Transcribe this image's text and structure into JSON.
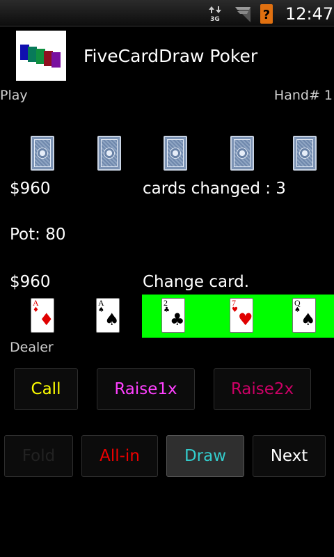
{
  "status_bar": {
    "network": "3G",
    "time": "12:47",
    "icons": [
      "data-arrows-icon",
      "signal-icon",
      "alert-icon"
    ]
  },
  "header": {
    "title": "FiveCardDraw Poker",
    "icon": "app-cards-icon"
  },
  "info": {
    "mode": "Play",
    "hand": "Hand# 1"
  },
  "opponent": {
    "money": "$960",
    "status": "cards changed : 3",
    "cards": [
      "back",
      "back",
      "back",
      "back",
      "back"
    ]
  },
  "pot": "Pot: 80",
  "player": {
    "money": "$960",
    "status": "Change card.",
    "role": "Dealer",
    "cards": [
      {
        "rank": "A",
        "suit": "♦",
        "color": "red",
        "selected": false
      },
      {
        "rank": "A",
        "suit": "♠",
        "color": "black",
        "selected": false
      },
      {
        "rank": "2",
        "suit": "♣",
        "color": "black",
        "selected": true
      },
      {
        "rank": "7",
        "suit": "♥",
        "color": "red",
        "selected": true
      },
      {
        "rank": "Q",
        "suit": "♠",
        "color": "black",
        "selected": true
      }
    ],
    "selected_color": "#00ff00"
  },
  "buttons": {
    "call": {
      "label": "Call",
      "color": "#ffff00"
    },
    "raise1x": {
      "label": "Raise1x",
      "color": "#ff40ff"
    },
    "raise2x": {
      "label": "Raise2x",
      "color": "#cc0066"
    },
    "fold": {
      "label": "Fold",
      "color": "#222222"
    },
    "allin": {
      "label": "All-in",
      "color": "#ee0000"
    },
    "draw": {
      "label": "Draw",
      "color": "#33cccc"
    },
    "next": {
      "label": "Next",
      "color": "#ffffff"
    }
  }
}
